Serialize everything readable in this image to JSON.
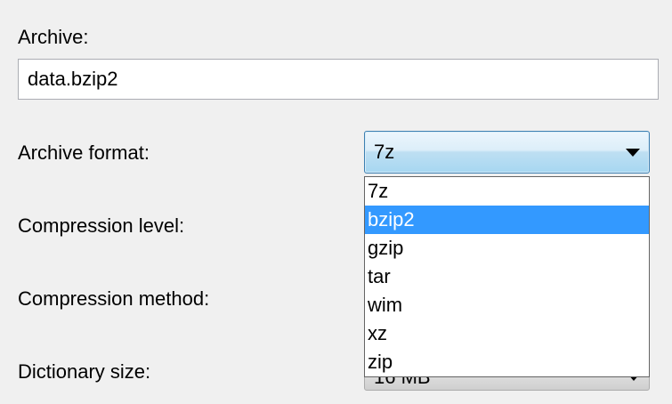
{
  "form": {
    "archive_label": "Archive:",
    "archive_value": "data.bzip2",
    "format_label": "Archive format:",
    "level_label": "Compression level:",
    "method_label": "Compression method:",
    "dictionary_label": "Dictionary size:",
    "dictionary_value": "16 MB"
  },
  "format_combo": {
    "selected": "7z",
    "highlighted": "bzip2",
    "options": [
      "7z",
      "bzip2",
      "gzip",
      "tar",
      "wim",
      "xz",
      "zip"
    ]
  },
  "colors": {
    "highlight": "#3399ff",
    "window_bg": "#f0f0f0"
  }
}
